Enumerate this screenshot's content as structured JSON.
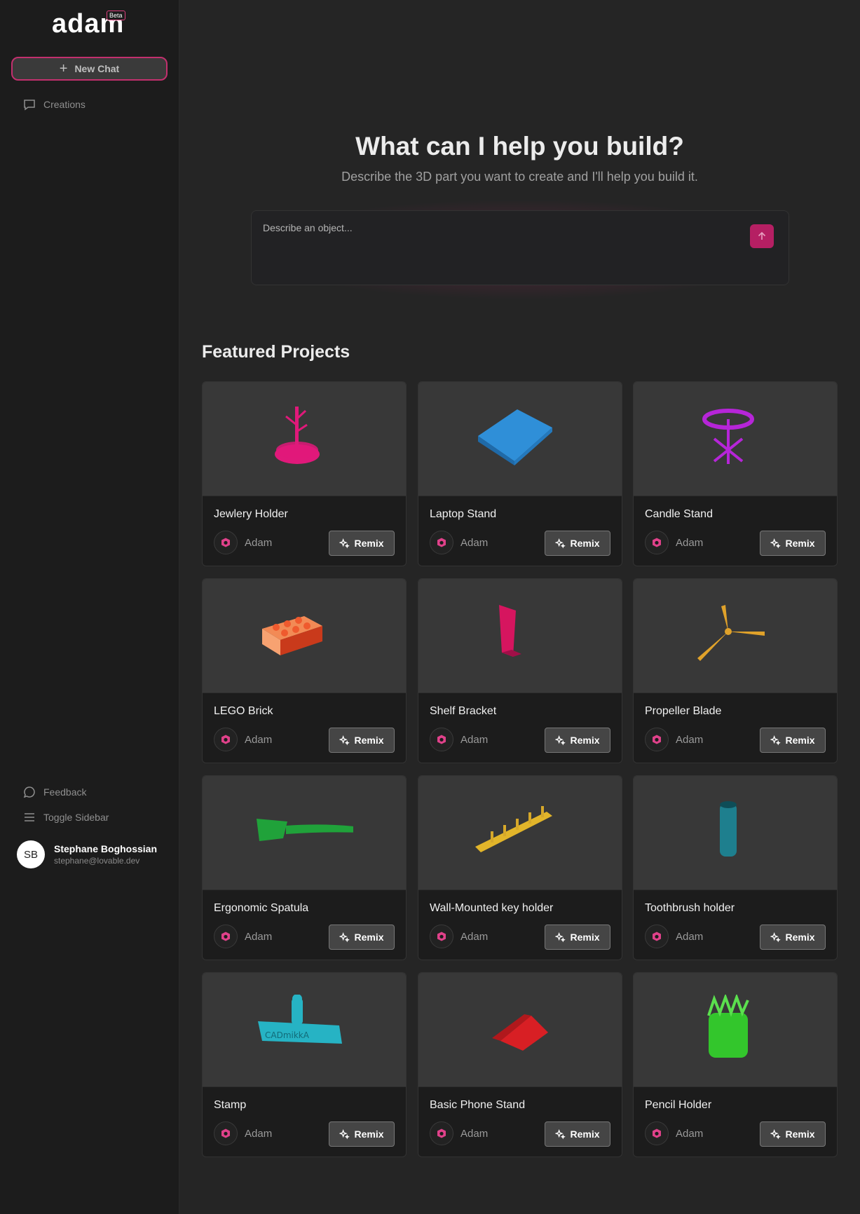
{
  "app": {
    "logo": "adam",
    "badge": "Beta"
  },
  "sidebar": {
    "new_chat": "New Chat",
    "creations": "Creations",
    "feedback": "Feedback",
    "toggle_sidebar": "Toggle Sidebar",
    "user": {
      "initials": "SB",
      "name": "Stephane Boghossian",
      "email": "stephane@lovable.dev"
    }
  },
  "hero": {
    "title": "What can I help you build?",
    "subtitle": "Describe the 3D part you want to create and I'll help you build it.",
    "placeholder": "Describe an object..."
  },
  "featured": {
    "title": "Featured Projects",
    "remix_label": "Remix",
    "author": "Adam",
    "projects": [
      {
        "title": "Jewlery Holder",
        "color": "#e0197a"
      },
      {
        "title": "Laptop Stand",
        "color": "#2f8fd8"
      },
      {
        "title": "Candle Stand",
        "color": "#b625d8"
      },
      {
        "title": "LEGO Brick",
        "color": "#ef5a2e"
      },
      {
        "title": "Shelf Bracket",
        "color": "#d6155f"
      },
      {
        "title": "Propeller Blade",
        "color": "#e0a22a"
      },
      {
        "title": "Ergonomic Spatula",
        "color": "#20a23a"
      },
      {
        "title": "Wall-Mounted key holder",
        "color": "#e2b52a"
      },
      {
        "title": "Toothbrush holder",
        "color": "#1e7f8e"
      },
      {
        "title": "Stamp",
        "color": "#26b3c4"
      },
      {
        "title": "Basic Phone Stand",
        "color": "#d81f24"
      },
      {
        "title": "Pencil Holder",
        "color": "#33c62c"
      }
    ]
  }
}
